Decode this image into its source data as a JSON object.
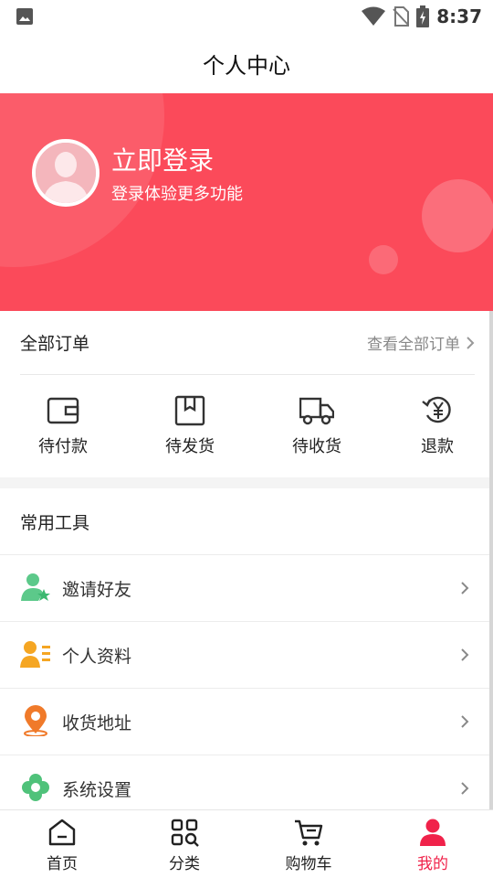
{
  "status_bar": {
    "time": "8:37"
  },
  "header": {
    "title": "个人中心"
  },
  "profile": {
    "login_title": "立即登录",
    "login_subtitle": "登录体验更多功能"
  },
  "orders": {
    "title": "全部订单",
    "view_all": "查看全部订单",
    "items": [
      {
        "label": "待付款",
        "icon": "wallet-icon"
      },
      {
        "label": "待发货",
        "icon": "box-icon"
      },
      {
        "label": "待收货",
        "icon": "truck-icon"
      },
      {
        "label": "退款",
        "icon": "refund-icon"
      }
    ]
  },
  "tools": {
    "title": "常用工具",
    "items": [
      {
        "label": "邀请好友",
        "icon": "invite-friend-icon"
      },
      {
        "label": "个人资料",
        "icon": "profile-card-icon"
      },
      {
        "label": "收货地址",
        "icon": "location-pin-icon"
      },
      {
        "label": "系统设置",
        "icon": "settings-gear-icon"
      }
    ]
  },
  "bottom_nav": {
    "items": [
      {
        "label": "首页",
        "icon": "home-icon"
      },
      {
        "label": "分类",
        "icon": "category-icon"
      },
      {
        "label": "购物车",
        "icon": "cart-icon"
      },
      {
        "label": "我的",
        "icon": "user-icon",
        "active": true
      }
    ]
  },
  "colors": {
    "brand": "#fb4a5a",
    "active_tab": "#f0224a",
    "invite": "#5cc98a",
    "profile": "#f5a623",
    "address": "#f07a2a",
    "settings": "#4fc27a"
  }
}
